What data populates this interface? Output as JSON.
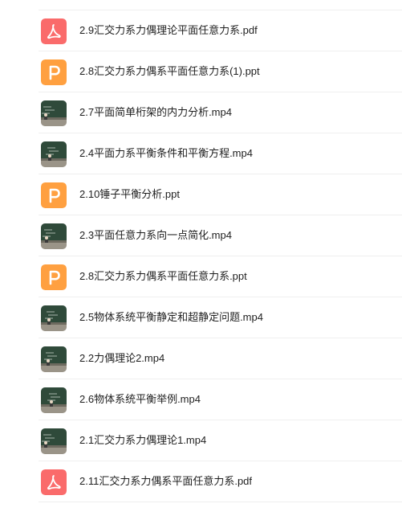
{
  "files": [
    {
      "name": "2.9汇交力系力偶理论平面任意力系.pdf",
      "type": "pdf",
      "icon": "pdf-icon"
    },
    {
      "name": "2.8汇交力系力偶系平面任意力系(1).ppt",
      "type": "ppt",
      "icon": "ppt-icon"
    },
    {
      "name": "2.7平面简单桁架的内力分析.mp4",
      "type": "mp4",
      "icon": "video-thumbnail"
    },
    {
      "name": "2.4平面力系平衡条件和平衡方程.mp4",
      "type": "mp4",
      "icon": "video-thumbnail"
    },
    {
      "name": "2.10锤子平衡分析.ppt",
      "type": "ppt",
      "icon": "ppt-icon"
    },
    {
      "name": "2.3平面任意力系向一点简化.mp4",
      "type": "mp4",
      "icon": "video-thumbnail"
    },
    {
      "name": "2.8汇交力系力偶系平面任意力系.ppt",
      "type": "ppt",
      "icon": "ppt-icon"
    },
    {
      "name": "2.5物体系统平衡静定和超静定问题.mp4",
      "type": "mp4",
      "icon": "video-thumbnail"
    },
    {
      "name": "2.2力偶理论2.mp4",
      "type": "mp4",
      "icon": "video-thumbnail"
    },
    {
      "name": "2.6物体系统平衡举例.mp4",
      "type": "mp4",
      "icon": "video-thumbnail"
    },
    {
      "name": "2.1汇交力系力偶理论1.mp4",
      "type": "mp4",
      "icon": "video-thumbnail"
    },
    {
      "name": "2.11汇交力系力偶系平面任意力系.pdf",
      "type": "pdf",
      "icon": "pdf-icon"
    }
  ],
  "colors": {
    "pdf": "#fa6b6b",
    "ppt": "#ffa040",
    "divider": "#efefef",
    "text": "#1f1f1f"
  }
}
